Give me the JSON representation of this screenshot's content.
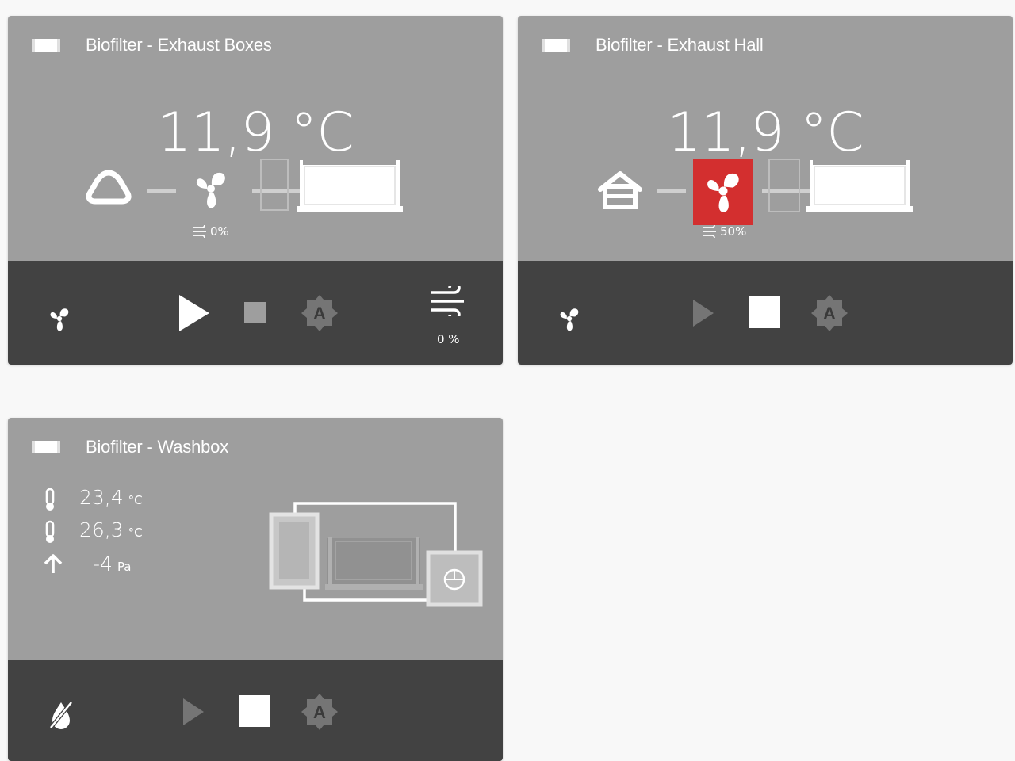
{
  "cards": [
    {
      "title": "Biofilter - Exhaust Boxes",
      "temperature": "11,9 °C",
      "fan_percent": "0%",
      "fan_running": false,
      "controls": {
        "airflow_percent": "0 %",
        "auto_badge": "A"
      },
      "icons": [
        "biofilter-icon",
        "cloud-icon",
        "fan-icon",
        "airflow-icon",
        "play-icon",
        "stop-icon",
        "auto-mode-icon"
      ]
    },
    {
      "title": "Biofilter - Exhaust Hall",
      "temperature": "11,9 °C",
      "fan_percent": "50%",
      "fan_running": true,
      "controls": {
        "auto_badge": "A"
      },
      "icons": [
        "biofilter-icon",
        "home-icon",
        "fan-icon",
        "airflow-icon",
        "play-icon",
        "stop-icon",
        "auto-mode-icon"
      ]
    },
    {
      "title": "Biofilter - Washbox",
      "readings": [
        {
          "icon": "thermometer-icon",
          "value": "23,4",
          "unit": "°C"
        },
        {
          "icon": "thermometer-icon",
          "value": "26,3",
          "unit": "°C"
        },
        {
          "icon": "arrow-up-icon",
          "value": "-4",
          "unit": "Pa"
        }
      ],
      "controls": {
        "auto_badge": "A"
      },
      "icons": [
        "biofilter-icon",
        "water-off-icon",
        "play-icon",
        "stop-icon",
        "auto-mode-icon"
      ]
    }
  ],
  "colors": {
    "page_bg": "#f8f8f8",
    "card_top": "#9e9e9e",
    "card_bottom": "#424242",
    "fan_active": "#d32f2f",
    "auto_badge_bg": "#757575"
  }
}
